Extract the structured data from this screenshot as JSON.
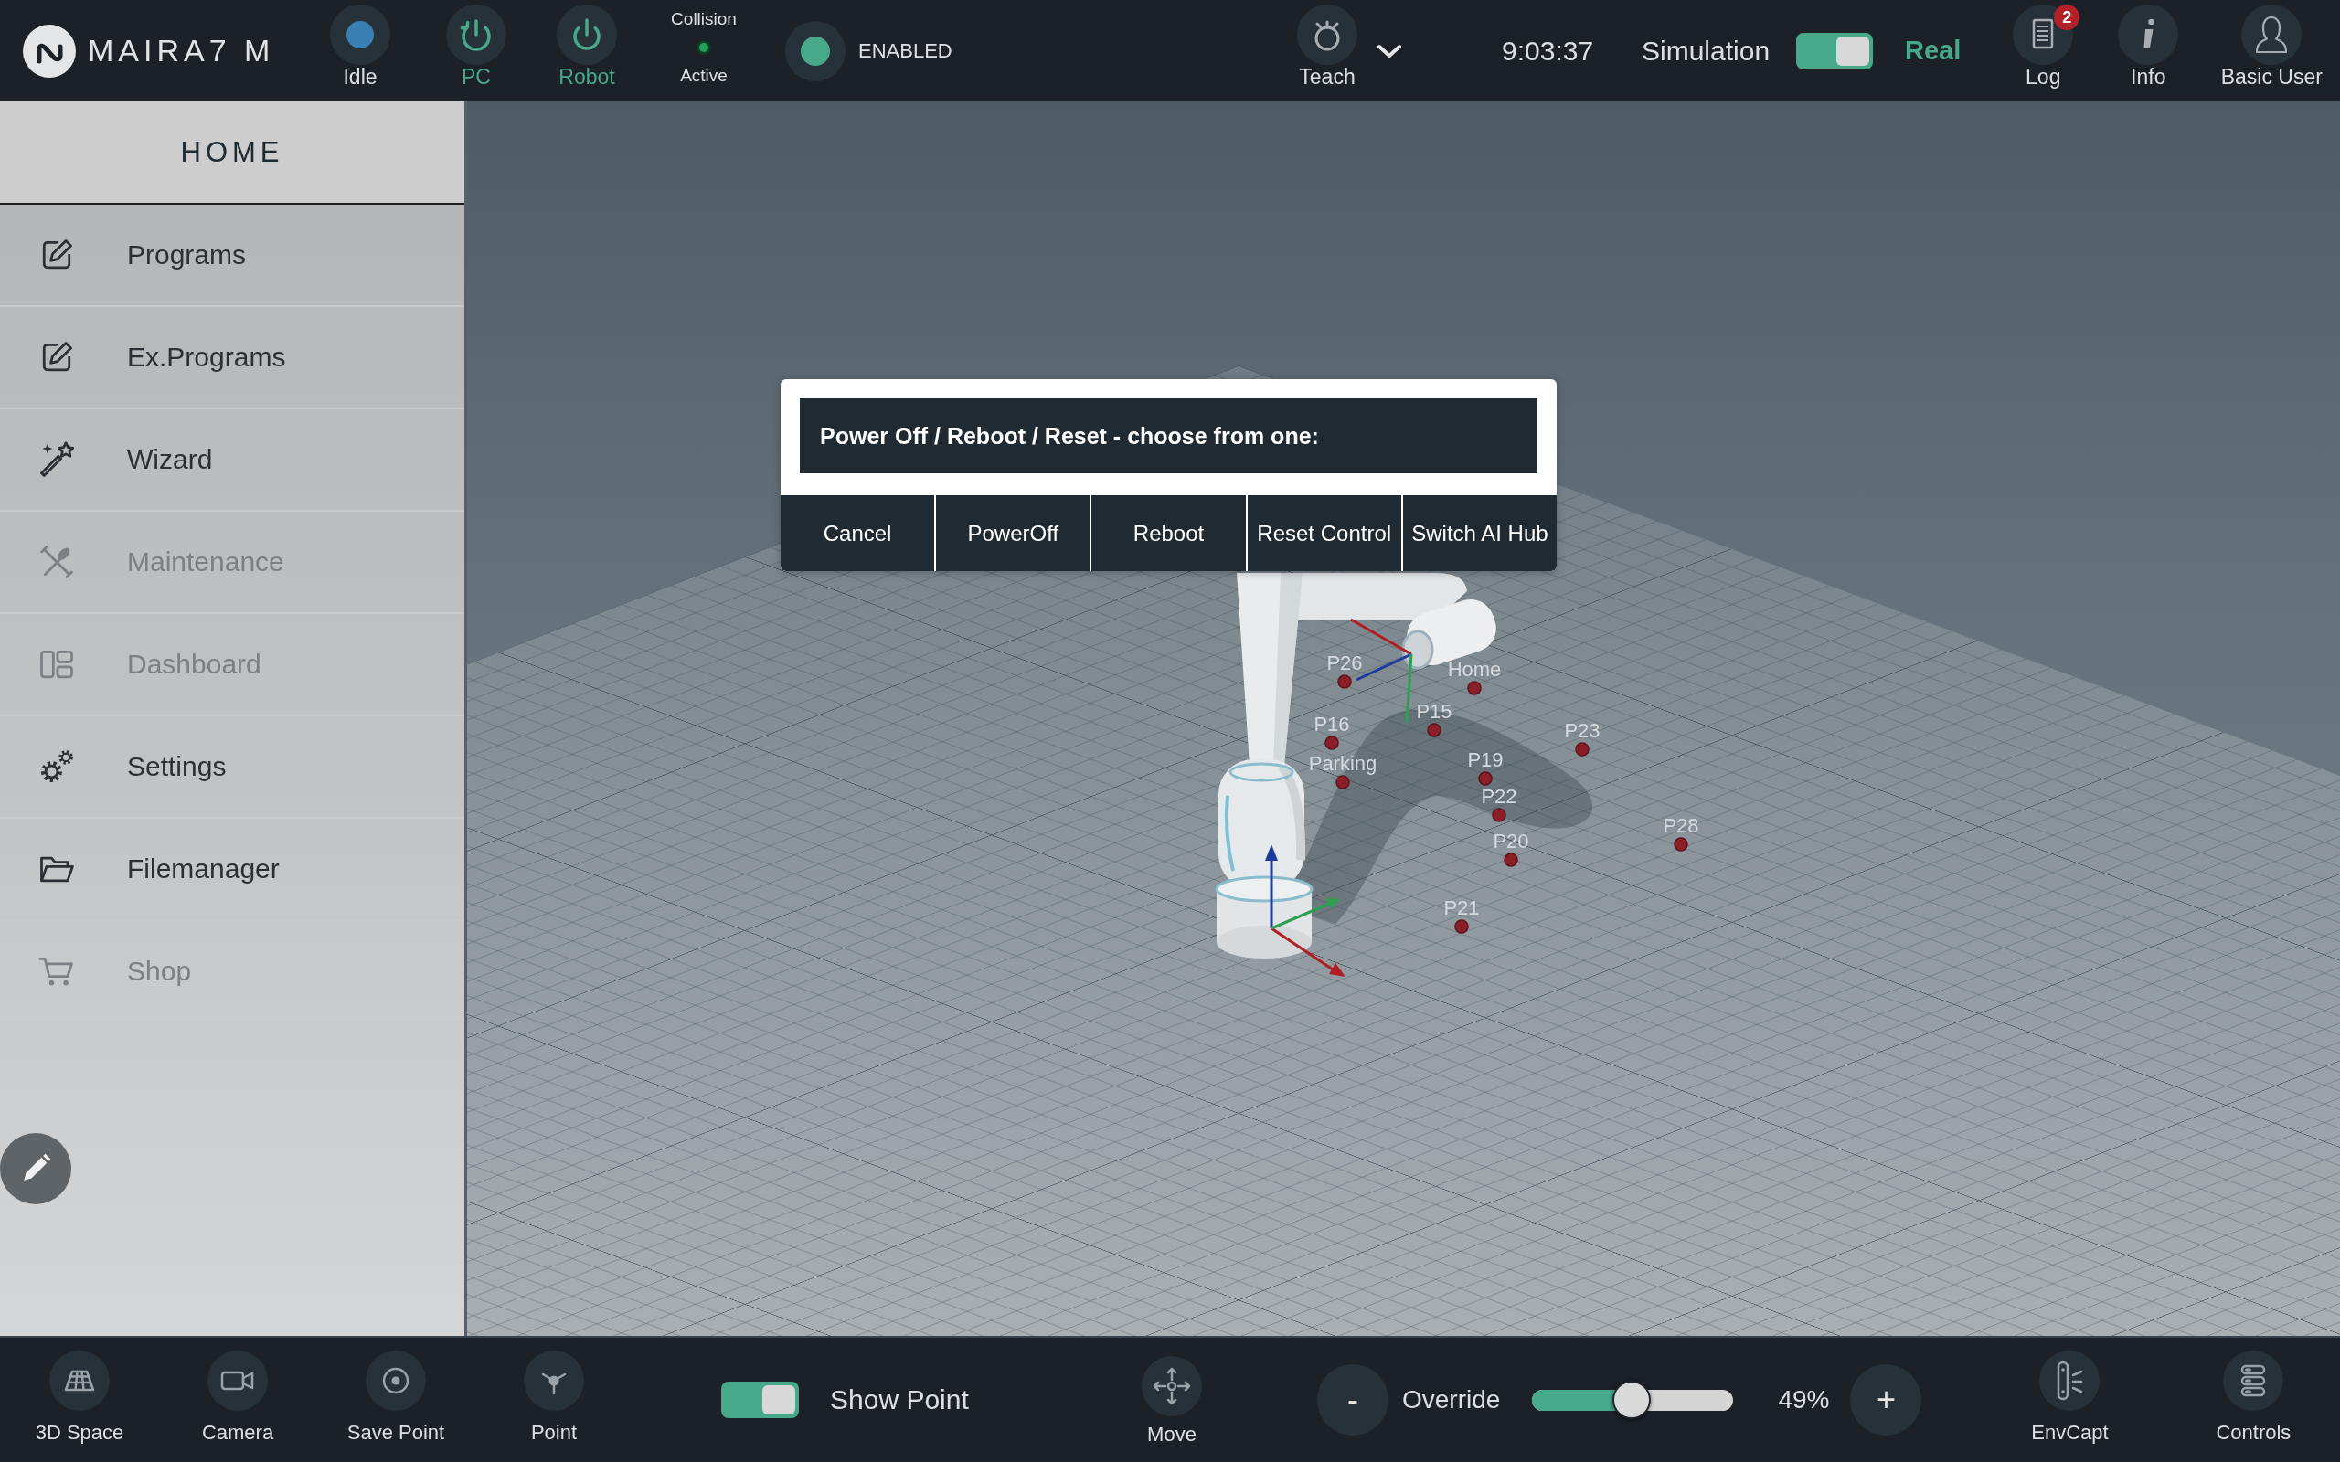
{
  "top_bar": {
    "brand": "MAIRA7 M",
    "indicators": [
      {
        "kind": "dot",
        "label": "Idle",
        "color": "#3a80b4",
        "on": false
      },
      {
        "kind": "restart",
        "label": "PC",
        "on": true
      },
      {
        "kind": "power",
        "label": "Robot",
        "on": true
      }
    ],
    "collision": {
      "title": "Collision",
      "status": "Active",
      "active": true
    },
    "enable": {
      "label": "ENABLED",
      "on": true
    },
    "teach": {
      "label": "Teach"
    },
    "clock": "9:03:37",
    "mode": {
      "left_label": "Simulation",
      "right_label": "Real",
      "on": true
    },
    "actions": [
      {
        "kind": "log",
        "label": "Log",
        "badge": "2"
      },
      {
        "kind": "info",
        "label": "Info"
      },
      {
        "kind": "user",
        "label": "Basic User"
      }
    ]
  },
  "sidebar": {
    "title": "HOME",
    "items": [
      {
        "kind": "edit",
        "label": "Programs",
        "disabled": false
      },
      {
        "kind": "edit",
        "label": "Ex.Programs",
        "disabled": false
      },
      {
        "kind": "wand",
        "label": "Wizard",
        "disabled": false
      },
      {
        "kind": "tools",
        "label": "Maintenance",
        "disabled": true
      },
      {
        "kind": "dashboard",
        "label": "Dashboard",
        "disabled": true
      },
      {
        "kind": "gears",
        "label": "Settings",
        "disabled": false
      },
      {
        "kind": "folder",
        "label": "Filemanager",
        "disabled": false
      },
      {
        "kind": "cart",
        "label": "Shop",
        "disabled": true
      }
    ]
  },
  "scene": {
    "waypoints": [
      "P26",
      "Home",
      "P15",
      "P16",
      "Parking",
      "P19",
      "P23",
      "P22",
      "P20",
      "P28",
      "P21"
    ]
  },
  "dialog": {
    "title": "Power Off / Reboot / Reset - choose from one:",
    "buttons": [
      "Cancel",
      "PowerOff",
      "Reboot",
      "Reset Control",
      "Switch AI Hub"
    ]
  },
  "bottom_bar": {
    "tools": [
      {
        "kind": "grid",
        "label": "3D Space"
      },
      {
        "kind": "camera",
        "label": "Camera"
      },
      {
        "kind": "target",
        "label": "Save Point"
      },
      {
        "kind": "point",
        "label": "Point"
      }
    ],
    "show_point": {
      "label": "Show Point",
      "on": true
    },
    "move": {
      "label": "Move"
    },
    "override": {
      "decrease": "-",
      "label": "Override",
      "level": 0.49,
      "reading": "49%",
      "increase": "+"
    },
    "tools_right": [
      {
        "kind": "sensor",
        "label": "EnvCapt"
      },
      {
        "kind": "stack",
        "label": "Controls"
      }
    ]
  }
}
